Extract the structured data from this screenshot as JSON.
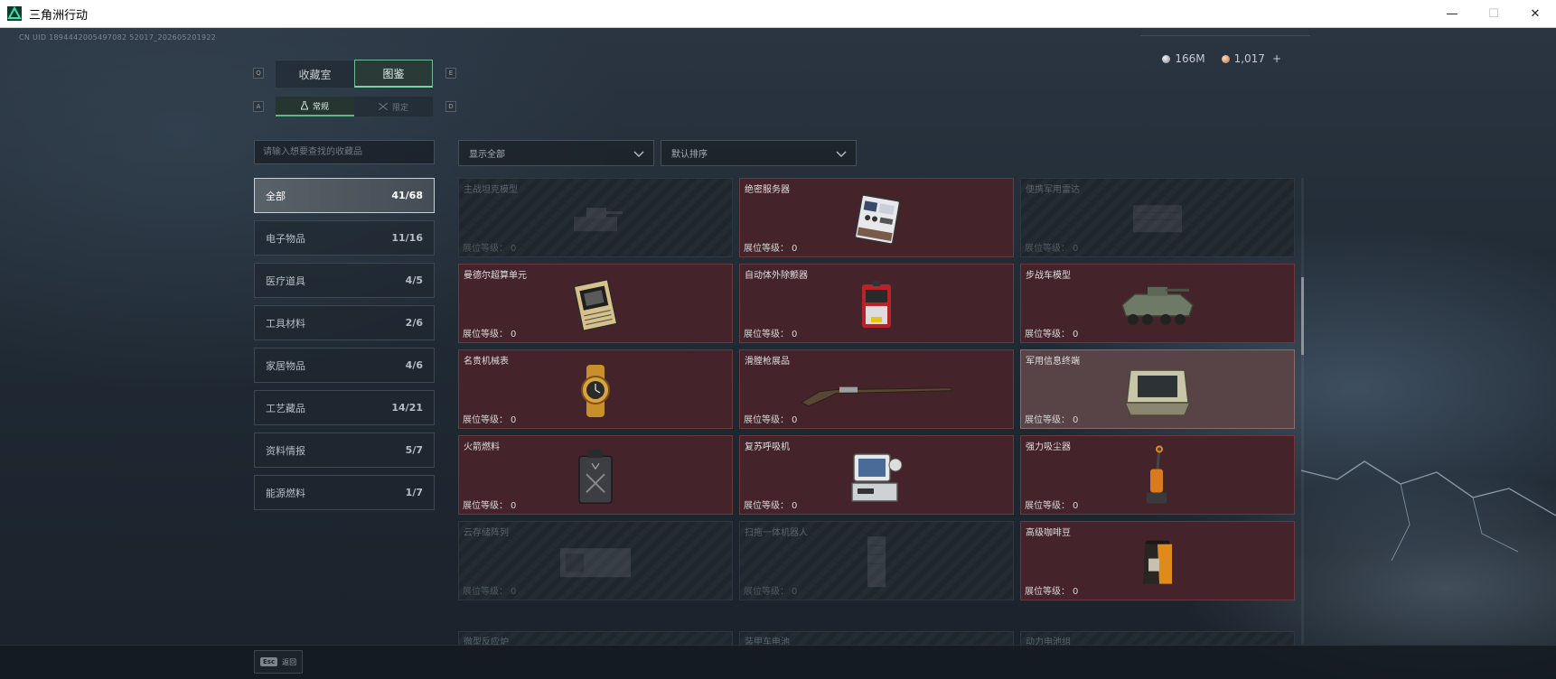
{
  "window": {
    "title": "三角洲行动",
    "minimize": "—",
    "maximize": "☐",
    "close": "✕"
  },
  "uid": "CN UID 1894442005497082 52017_202605201922",
  "currency": {
    "silver": "166M",
    "gold": "1,017",
    "add": "+"
  },
  "tabs": {
    "left_key": "Q",
    "right_key": "E",
    "items": [
      "收藏室",
      "图鉴"
    ],
    "active": 1
  },
  "subtabs": {
    "left_key": "A",
    "right_key": "D",
    "items": [
      "常规",
      "限定"
    ],
    "active": 0
  },
  "search": {
    "placeholder": "请输入想要查找的收藏品"
  },
  "filters": {
    "display": "显示全部",
    "sort": "默认排序"
  },
  "categories": [
    {
      "label": "全部",
      "count": "41/68"
    },
    {
      "label": "电子物品",
      "count": "11/16"
    },
    {
      "label": "医疗道具",
      "count": "4/5"
    },
    {
      "label": "工具材料",
      "count": "2/6"
    },
    {
      "label": "家居物品",
      "count": "4/6"
    },
    {
      "label": "工艺藏品",
      "count": "14/21"
    },
    {
      "label": "资料情报",
      "count": "5/7"
    },
    {
      "label": "能源燃料",
      "count": "1/7"
    }
  ],
  "level_label": "展位等级：",
  "items": [
    {
      "name": "主战坦克模型",
      "level": "0",
      "state": "locked",
      "icon": "tank-model-icon"
    },
    {
      "name": "绝密服务器",
      "level": "0",
      "state": "owned",
      "icon": "server-icon"
    },
    {
      "name": "便携军用雷达",
      "level": "0",
      "state": "locked",
      "icon": "radar-icon"
    },
    {
      "name": "曼德尔超算单元",
      "level": "0",
      "state": "owned",
      "icon": "cpu-board-icon"
    },
    {
      "name": "自动体外除颤器",
      "level": "0",
      "state": "owned",
      "icon": "defibrillator-icon"
    },
    {
      "name": "步战车模型",
      "level": "0",
      "state": "owned",
      "icon": "ifv-model-icon"
    },
    {
      "name": "名贵机械表",
      "level": "0",
      "state": "owned",
      "icon": "watch-icon"
    },
    {
      "name": "滑膛枪展品",
      "level": "0",
      "state": "owned",
      "icon": "musket-icon"
    },
    {
      "name": "军用信息终端",
      "level": "0",
      "state": "highlight",
      "icon": "terminal-icon"
    },
    {
      "name": "火箭燃料",
      "level": "0",
      "state": "owned",
      "icon": "fuel-can-icon"
    },
    {
      "name": "复苏呼吸机",
      "level": "0",
      "state": "owned",
      "icon": "ventilator-icon"
    },
    {
      "name": "强力吸尘器",
      "level": "0",
      "state": "owned",
      "icon": "vacuum-icon"
    },
    {
      "name": "云存储阵列",
      "level": "0",
      "state": "locked",
      "icon": "storage-array-icon"
    },
    {
      "name": "扫拖一体机器人",
      "level": "0",
      "state": "locked",
      "icon": "robot-vacuum-icon"
    },
    {
      "name": "高级咖啡豆",
      "level": "0",
      "state": "owned",
      "icon": "coffee-bag-icon"
    }
  ],
  "partial_items": [
    "微型反应炉",
    "装甲车电池",
    "动力电池组"
  ],
  "bottom": {
    "esc_key": "Esc",
    "esc_label": "返回"
  },
  "colors": {
    "accent": "#7fd0ab",
    "owned_card": "#44242a",
    "highlight_card": "#584447",
    "locked_card": "#1f262d"
  }
}
